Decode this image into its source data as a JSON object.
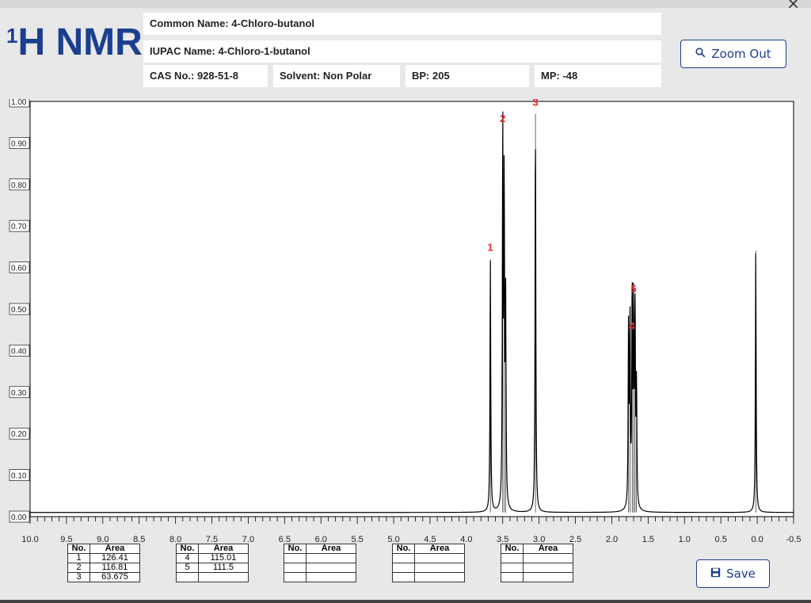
{
  "header": {
    "logo_main": "H NMR",
    "logo_sup": "1",
    "common_name": "Common Name: 4-Chloro-butanol",
    "iupac_name": "IUPAC Name: 4-Chloro-1-butanol",
    "cas": "CAS No.: 928-51-8",
    "solvent": "Solvent: Non Polar",
    "bp": "BP: 205",
    "mp": "MP: -48",
    "close_glyph": "×"
  },
  "buttons": {
    "zoom_out": "Zoom Out",
    "zoom_icon": "magnifier-icon",
    "save": "Save",
    "save_icon": "floppy-disk-icon"
  },
  "chart_data": {
    "type": "line",
    "title": "",
    "xlabel": "",
    "ylabel": "",
    "xlim": [
      10.0,
      -0.5
    ],
    "ylim": [
      0.0,
      1.0
    ],
    "x_ticks": [
      "10.0",
      "9.5",
      "9.0",
      "8.5",
      "8.0",
      "7.5",
      "7.0",
      "6.5",
      "6.0",
      "5.5",
      "5.0",
      "4.5",
      "4.0",
      "3.5",
      "3.0",
      "2.5",
      "2.0",
      "1.5",
      "1.0",
      "0.5",
      "0.0",
      "-0.5"
    ],
    "y_ticks": [
      "1.00",
      "0.90",
      "0.80",
      "0.70",
      "0.60",
      "0.50",
      "0.40",
      "0.30",
      "0.20",
      "0.10",
      "0.00"
    ],
    "baseline": 0.01,
    "line_color": "#000000",
    "label_color": "#e8262c",
    "peaks": [
      {
        "ppm": 3.67,
        "height": 0.62
      },
      {
        "ppm": 3.5,
        "height": 0.93
      },
      {
        "ppm": 3.48,
        "height": 0.78
      },
      {
        "ppm": 3.46,
        "height": 0.5
      },
      {
        "ppm": 3.05,
        "height": 0.97
      },
      {
        "ppm": 1.77,
        "height": 0.44
      },
      {
        "ppm": 1.75,
        "height": 0.46
      },
      {
        "ppm": 1.72,
        "height": 0.53
      },
      {
        "ppm": 1.7,
        "height": 0.47
      },
      {
        "ppm": 1.68,
        "height": 0.48
      },
      {
        "ppm": 1.66,
        "height": 0.3
      },
      {
        "ppm": 0.02,
        "height": 0.64
      }
    ],
    "peak_labels": [
      {
        "label": "1",
        "ppm": 3.67,
        "y": 0.64
      },
      {
        "label": "2",
        "ppm": 3.5,
        "y": 0.95
      },
      {
        "label": "3",
        "ppm": 3.05,
        "y": 0.99
      },
      {
        "label": "4",
        "ppm": 1.72,
        "y": 0.45
      },
      {
        "label": "5",
        "ppm": 1.7,
        "y": 0.54
      }
    ]
  },
  "peak_tables": [
    {
      "headers": [
        "No.",
        "Area"
      ],
      "rows": [
        [
          "1",
          "126.41"
        ],
        [
          "2",
          "116.81"
        ],
        [
          "3",
          "63.675"
        ]
      ]
    },
    {
      "headers": [
        "No.",
        "Area"
      ],
      "rows": [
        [
          "4",
          "115.01"
        ],
        [
          "5",
          "111.5"
        ],
        [
          "",
          ""
        ]
      ]
    },
    {
      "headers": [
        "No.",
        "Area"
      ],
      "rows": [
        [
          "",
          ""
        ],
        [
          "",
          ""
        ],
        [
          "",
          ""
        ]
      ]
    },
    {
      "headers": [
        "No.",
        "Area"
      ],
      "rows": [
        [
          "",
          ""
        ],
        [
          "",
          ""
        ],
        [
          "",
          ""
        ]
      ]
    },
    {
      "headers": [
        "No.",
        "Area"
      ],
      "rows": [
        [
          "",
          ""
        ],
        [
          "",
          ""
        ],
        [
          "",
          ""
        ]
      ]
    }
  ]
}
